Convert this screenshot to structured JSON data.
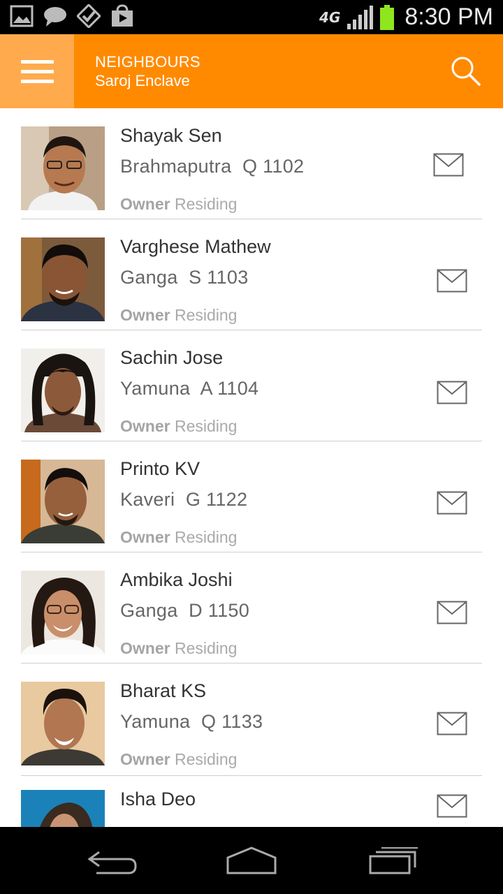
{
  "status_bar": {
    "network": "4G",
    "time": "8:30 PM",
    "battery_color": "#8ee61e",
    "notification_icons": [
      "gallery-icon",
      "chat-icon",
      "check-icon",
      "store-icon"
    ]
  },
  "app_bar": {
    "title": "NEIGHBOURS",
    "subtitle": "Saroj Enclave",
    "accent": "#ff8a00"
  },
  "neighbours": [
    {
      "name": "Shayak Sen",
      "address": "Brahmaputra  Q 1102",
      "role": "Owner",
      "status": "Residing"
    },
    {
      "name": "Varghese Mathew",
      "address": "Ganga  S 1103",
      "role": "Owner",
      "status": "Residing"
    },
    {
      "name": "Sachin Jose",
      "address": "Yamuna  A 1104",
      "role": "Owner",
      "status": "Residing"
    },
    {
      "name": "Printo KV",
      "address": "Kaveri  G 1122",
      "role": "Owner",
      "status": "Residing"
    },
    {
      "name": "Ambika Joshi",
      "address": "Ganga  D 1150",
      "role": "Owner",
      "status": "Residing"
    },
    {
      "name": "Bharat KS",
      "address": "Yamuna  Q 1133",
      "role": "Owner",
      "status": "Residing"
    },
    {
      "name": "Isha Deo",
      "address": "",
      "role": "",
      "status": ""
    }
  ]
}
